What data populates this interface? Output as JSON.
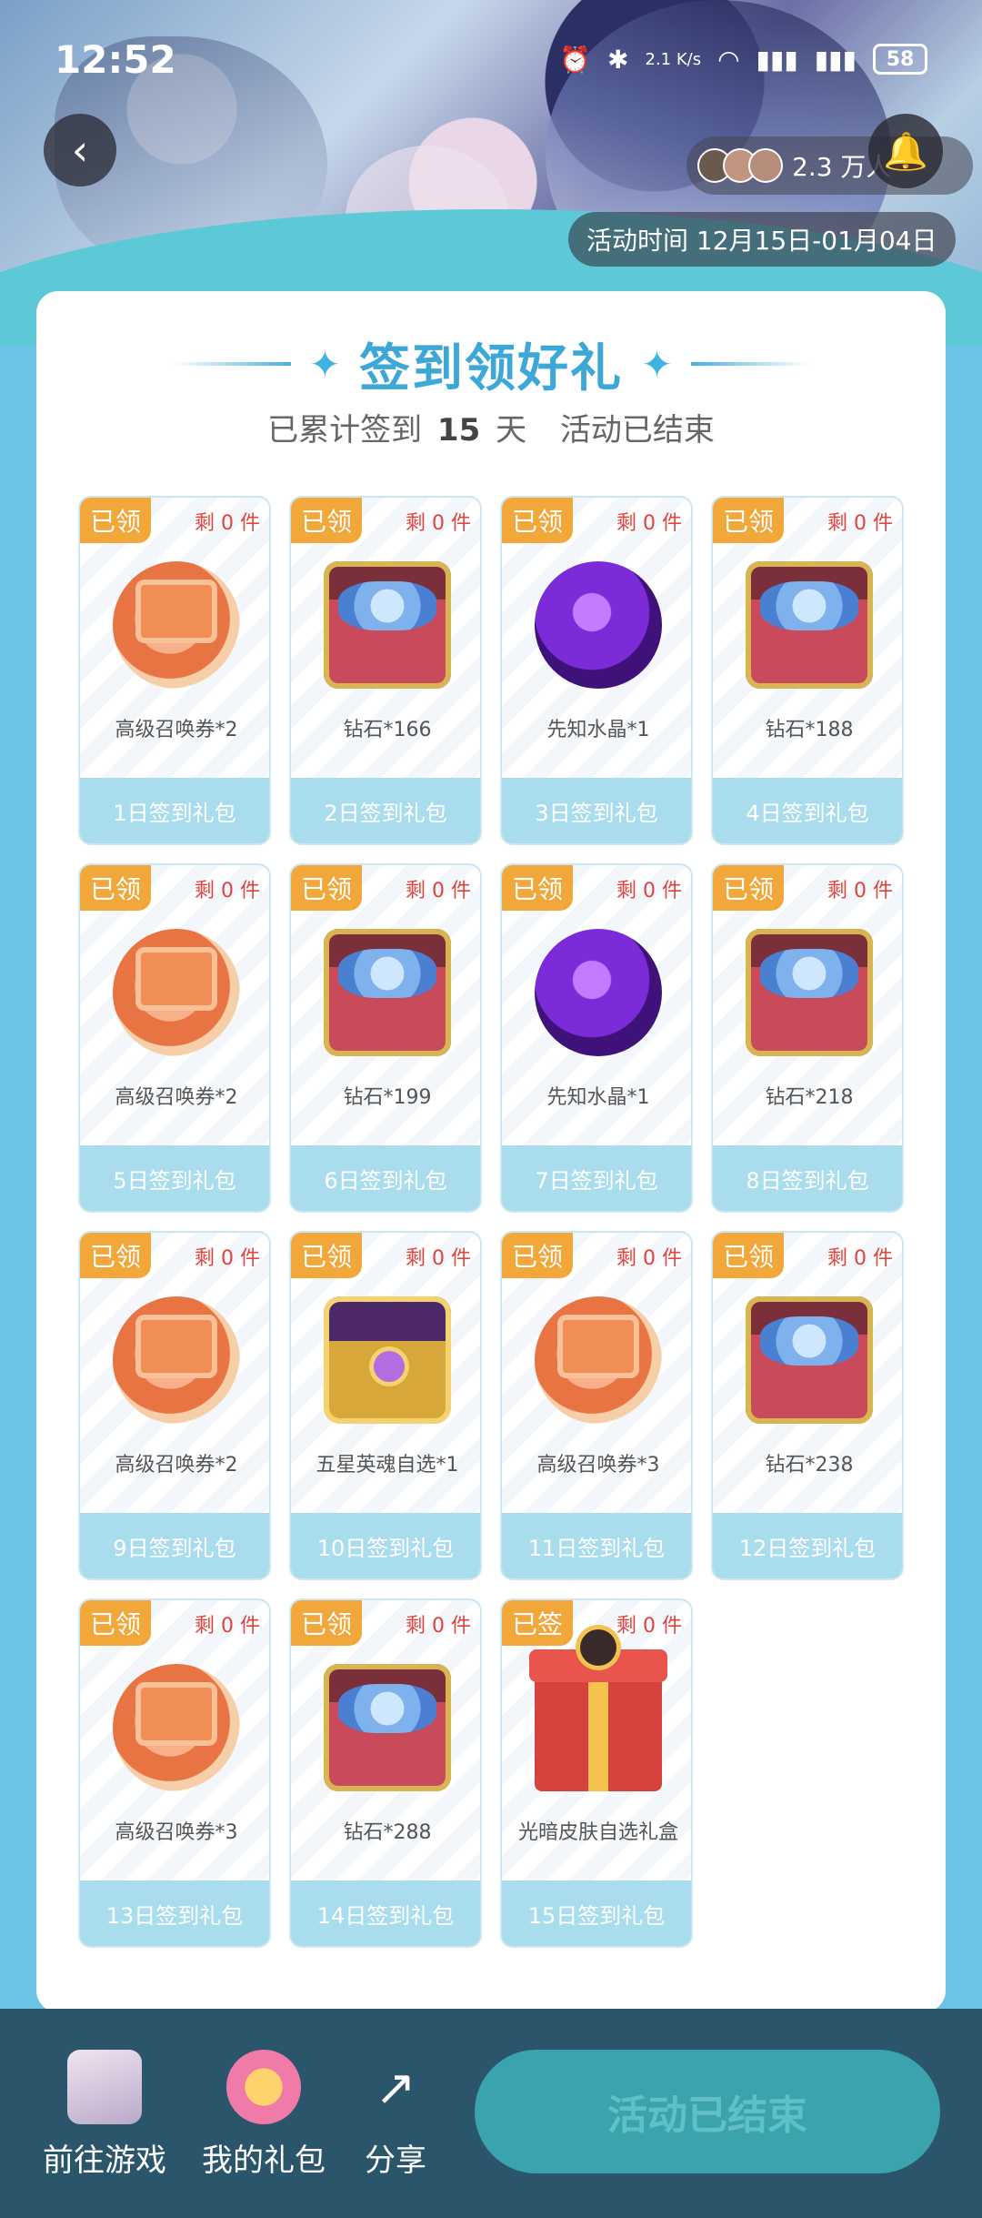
{
  "status": {
    "time": "12:52",
    "net_speed": "2.1 K/s",
    "battery": "58"
  },
  "header": {
    "viewers": "2.3 万人",
    "event_time": "活动时间 12月15日-01月04日"
  },
  "title": "签到领好礼",
  "subtitle": {
    "prefix": "已累计签到",
    "days": "15",
    "suffix": "天",
    "status": "活动已结束"
  },
  "items": [
    {
      "badge": "已领",
      "remain": "剩 0 件",
      "name": "高级召唤券*2",
      "day": "1日签到礼包",
      "icon": "ticket-icon"
    },
    {
      "badge": "已领",
      "remain": "剩 0 件",
      "name": "钻石*166",
      "day": "2日签到礼包",
      "icon": "diamond-chest-icon"
    },
    {
      "badge": "已领",
      "remain": "剩 0 件",
      "name": "先知水晶*1",
      "day": "3日签到礼包",
      "icon": "crystal-icon"
    },
    {
      "badge": "已领",
      "remain": "剩 0 件",
      "name": "钻石*188",
      "day": "4日签到礼包",
      "icon": "diamond-chest-icon"
    },
    {
      "badge": "已领",
      "remain": "剩 0 件",
      "name": "高级召唤券*2",
      "day": "5日签到礼包",
      "icon": "ticket-icon"
    },
    {
      "badge": "已领",
      "remain": "剩 0 件",
      "name": "钻石*199",
      "day": "6日签到礼包",
      "icon": "diamond-chest-icon"
    },
    {
      "badge": "已领",
      "remain": "剩 0 件",
      "name": "先知水晶*1",
      "day": "7日签到礼包",
      "icon": "crystal-icon"
    },
    {
      "badge": "已领",
      "remain": "剩 0 件",
      "name": "钻石*218",
      "day": "8日签到礼包",
      "icon": "diamond-chest-icon"
    },
    {
      "badge": "已领",
      "remain": "剩 0 件",
      "name": "高级召唤券*2",
      "day": "9日签到礼包",
      "icon": "ticket-icon"
    },
    {
      "badge": "已领",
      "remain": "剩 0 件",
      "name": "五星英魂自选*1",
      "day": "10日签到礼包",
      "icon": "gold-chest-icon"
    },
    {
      "badge": "已领",
      "remain": "剩 0 件",
      "name": "高级召唤券*3",
      "day": "11日签到礼包",
      "icon": "ticket-icon"
    },
    {
      "badge": "已领",
      "remain": "剩 0 件",
      "name": "钻石*238",
      "day": "12日签到礼包",
      "icon": "diamond-chest-icon"
    },
    {
      "badge": "已领",
      "remain": "剩 0 件",
      "name": "高级召唤券*3",
      "day": "13日签到礼包",
      "icon": "ticket-icon"
    },
    {
      "badge": "已领",
      "remain": "剩 0 件",
      "name": "钻石*288",
      "day": "14日签到礼包",
      "icon": "diamond-chest-icon"
    },
    {
      "badge": "已签",
      "remain": "剩 0 件",
      "name": "光暗皮肤自选礼盒",
      "day": "15日签到礼包",
      "icon": "gift-box-icon"
    }
  ],
  "bottom": {
    "nav": [
      {
        "label": "前往游戏",
        "icon": "game-avatar-icon"
      },
      {
        "label": "我的礼包",
        "icon": "gift-bag-icon"
      },
      {
        "label": "分享",
        "icon": "share-icon"
      }
    ],
    "end_button": "活动已结束"
  },
  "colors": {
    "badge": "#f2a73a",
    "accent": "#3da7d8",
    "remain": "#e0443e",
    "day_label": "#a9dcec",
    "bottom_bar": "#2a556b",
    "end_button": "#3aa3ad"
  }
}
